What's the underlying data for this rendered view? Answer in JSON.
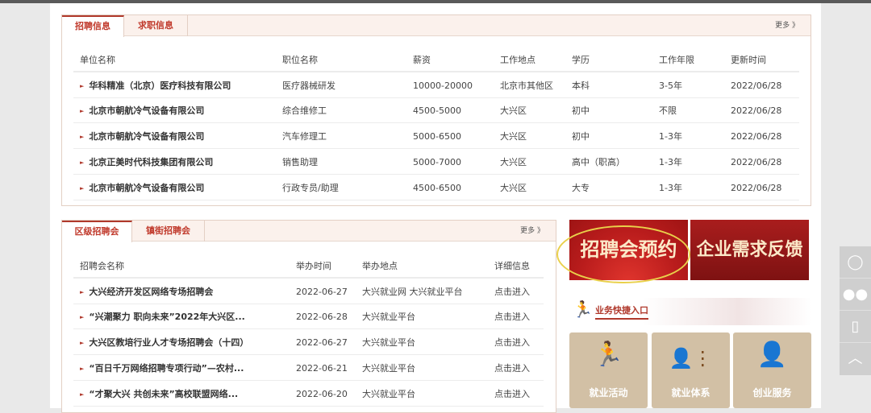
{
  "jobs": {
    "tabs": [
      "招聘信息",
      "求职信息"
    ],
    "more": "更多 》",
    "headers": [
      "单位名称",
      "职位名称",
      "薪资",
      "工作地点",
      "学历",
      "工作年限",
      "更新时间"
    ],
    "rows": [
      [
        "华科精准（北京）医疗科技有限公司",
        "医疗器械研发",
        "10000-20000",
        "北京市其他区",
        "本科",
        "3-5年",
        "2022/06/28"
      ],
      [
        "北京市朝航冷气设备有限公司",
        "综合维修工",
        "4500-5000",
        "大兴区",
        "初中",
        "不限",
        "2022/06/28"
      ],
      [
        "北京市朝航冷气设备有限公司",
        "汽车修理工",
        "5000-6500",
        "大兴区",
        "初中",
        "1-3年",
        "2022/06/28"
      ],
      [
        "北京正美时代科技集团有限公司",
        "销售助理",
        "5000-7000",
        "大兴区",
        "高中（职高）",
        "1-3年",
        "2022/06/28"
      ],
      [
        "北京市朝航冷气设备有限公司",
        "行政专员/助理",
        "4500-6500",
        "大兴区",
        "大专",
        "1-3年",
        "2022/06/28"
      ]
    ]
  },
  "fairs": {
    "tabs": [
      "区级招聘会",
      "镇街招聘会"
    ],
    "more": "更多 》",
    "headers": [
      "招聘会名称",
      "举办时间",
      "举办地点",
      "详细信息"
    ],
    "rows": [
      [
        "大兴经济开发区网络专场招聘会",
        "2022-06-27",
        "大兴就业网 大兴就业平台",
        "点击进入"
      ],
      [
        "“兴潮聚力 职向未来”2022年大兴区...",
        "2022-06-28",
        "大兴就业平台",
        "点击进入"
      ],
      [
        "大兴区教培行业人才专场招聘会（十四）",
        "2022-06-27",
        "大兴就业平台",
        "点击进入"
      ],
      [
        "“百日千万网络招聘专项行动”—农村...",
        "2022-06-21",
        "大兴就业平台",
        "点击进入"
      ],
      [
        "“才聚大兴 共创未来”高校联盟网络...",
        "2022-06-20",
        "大兴就业平台",
        "点击进入"
      ]
    ]
  },
  "banners": [
    "招聘会预约",
    "企业需求反馈"
  ],
  "quick_entry": {
    "title": "业务快捷入口",
    "tiles": [
      {
        "label": "就业活动",
        "icon": "running-man-icon"
      },
      {
        "label": "就业体系",
        "icon": "org-chart-icon"
      },
      {
        "label": "创业服务",
        "icon": "businessman-icon"
      }
    ]
  },
  "side_tools": [
    "user-icon",
    "wechat-icon",
    "mobile-icon",
    "back-to-top-icon"
  ]
}
